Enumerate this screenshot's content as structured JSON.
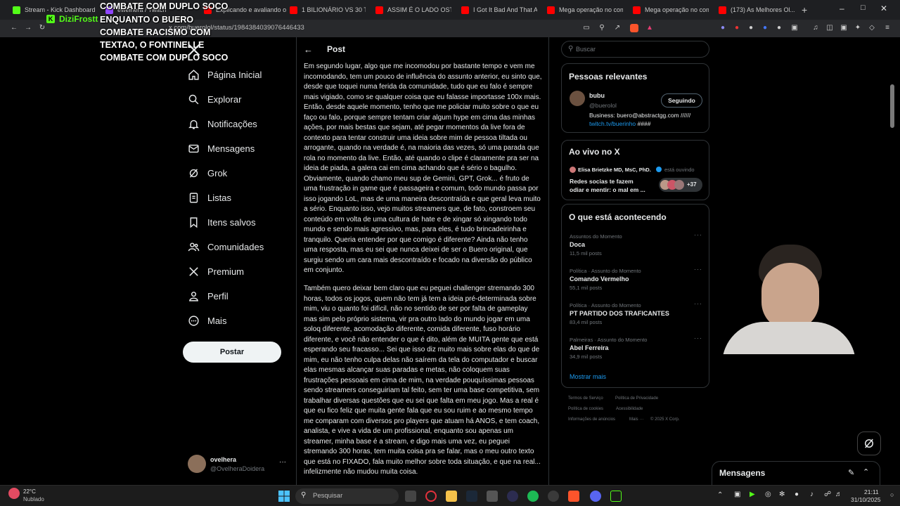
{
  "browser": {
    "tabs": [
      {
        "title": "Stream - Kick Dashboard",
        "color": "#53fc18"
      },
      {
        "title": "ewelhera / Twitch",
        "color": "#9146ff"
      },
      {
        "title": "Explicando e avaliando o...",
        "color": "#ff0000"
      },
      {
        "title": "1 BILIONÁRIO VS 30 TRA...",
        "color": "#ff0000"
      },
      {
        "title": "ASSIM É O LADO OSTEN...",
        "color": "#ff0000"
      },
      {
        "title": "I Got It Bad And That Ain...",
        "color": "#ff0000"
      },
      {
        "title": "Mega operação no comp...",
        "color": "#ff0000"
      },
      {
        "title": "Mega operação no comp...",
        "color": "#ff0000"
      },
      {
        "title": "(173) As Melhores Ol...",
        "color": "#ff0000"
      }
    ],
    "new_tab": "+",
    "url": "x.com/buerolol/status/1984384039076446433"
  },
  "overlay": {
    "brand": "DiziFrostt",
    "lines": [
      "COMBATE COM DUPLO SOCO",
      "ENQUANTO O BUERO",
      "COMBATE RACISMO COM",
      "TEXTAO, O FONTINELLE",
      "COMBATE COM DUPLO SOCO"
    ]
  },
  "nav": {
    "items": [
      {
        "label": "Página Inicial",
        "icon": "home-icon"
      },
      {
        "label": "Explorar",
        "icon": "search-icon"
      },
      {
        "label": "Notificações",
        "icon": "bell-icon"
      },
      {
        "label": "Mensagens",
        "icon": "mail-icon"
      },
      {
        "label": "Grok",
        "icon": "grok-icon"
      },
      {
        "label": "Listas",
        "icon": "list-icon"
      },
      {
        "label": "Itens salvos",
        "icon": "bookmark-icon"
      },
      {
        "label": "Comunidades",
        "icon": "people-icon"
      },
      {
        "label": "Premium",
        "icon": "x-logo-icon"
      },
      {
        "label": "Perfil",
        "icon": "person-icon"
      },
      {
        "label": "Mais",
        "icon": "more-circle-icon"
      }
    ],
    "post_button": "Postar",
    "account": {
      "name": "ovelhera",
      "handle": "@OvelheraDoidera"
    }
  },
  "post": {
    "header": "Post",
    "paragraph1": "Em segundo lugar, algo que me incomodou por bastante tempo e vem me incomodando, tem um pouco de influência do assunto anterior, eu sinto que, desde que toquei numa ferida da comunidade, tudo que eu falo é sempre mais vigiado, como se qualquer coisa que eu falasse importasse 100x mais. Então, desde aquele momento, tenho que me policiar muito sobre o que eu faço ou falo, porque sempre tentam criar algum hype em cima das minhas ações, por mais bestas que sejam, até pegar momentos da live fora de contexto para tentar construir uma ideia sobre mim de pessoa tiltada ou arrogante, quando na verdade é, na maioria das vezes, só uma parada que rola no momento da live. Então, até quando o clipe é claramente pra ser na ideia de piada, a galera cai em cima achando que é sério o bagulho. Obviamente, quando chamo meu sup de Gemini, GPT, Grok... é fruto de uma frustração in game que é passageira e comum, todo mundo passa por isso jogando LoL, mas de uma maneira descontraída e que geral leva muito a sério. Enquanto isso, vejo muitos streamers que, de fato, constroem seu conteúdo em volta de uma cultura de hate e de xingar só xingando todo mundo e sendo mais agressivo, mas, para eles, é tudo brincadeirinha e tranquilo. Queria entender por que comigo é diferente? Ainda não tenho uma resposta, mas eu sei que nunca deixei de ser o Buero original, que surgiu sendo um cara mais descontraído e focado na diversão do público em conjunto.",
    "paragraph2": "Também quero deixar bem claro que eu peguei challenger stremando 300 horas, todos os jogos, quem não tem já tem a ideia pré-determinada sobre mim, viu o quanto foi difícil, não no sentido de ser por falta de gameplay mas sim pelo próprio sistema, vir pra outro lado do mundo jogar em uma soloq diferente, acomodação diferente, comida diferente, fuso horário diferente, e você não entender o que é dito, além de MUITA gente que está esperando seu fracasso... Sei que isso diz muito mais sobre elas do que de mim, eu não tenho culpa delas não saírem da tela do computador e buscar elas mesmas alcançar suas paradas e metas, não coloquem suas frustrações pessoais em cima de mim, na verdade pouquíssimas pessoas sendo streamers conseguiriam tal feito, sem ter uma base competitiva, sem trabalhar diversas questões que eu sei que falta em meu jogo. Mas a real é que eu fico feliz que muita gente fala que eu sou ruim e ao mesmo tempo me comparam com diversos pro players que atuam há ANOS, e tem coach, analista, e vive a vida de um profissional, enquanto sou apenas um streamer, minha base é a stream, e digo mais uma vez, eu peguei stremando 300 horas, tem muita coisa pra se falar, mas o meu outro texto que está no FIXADO, fala muito melhor sobre toda situação, e que na real... infelizmente não mudou muita coisa."
  },
  "search": {
    "placeholder": "Buscar"
  },
  "relevant": {
    "title": "Pessoas relevantes",
    "name": "bubu",
    "handle": "@buerolol",
    "follow_button": "Seguindo",
    "bio_line1": "Business: buero@abstractgg.com //////",
    "bio_link": "twitch.tv/buerinho",
    "bio_suffix": " ####"
  },
  "live": {
    "title": "Ao vivo no X",
    "host": "Elisa Brietzke MD, MsC, PhD.",
    "status": "está ouvindo",
    "space_line1": "Redes socias te fazem",
    "space_line2": "odiar e mentir: o mal em ...",
    "listeners": "+37"
  },
  "trends": {
    "title": "O que está acontecendo",
    "items": [
      {
        "category": "Assuntos do Momento",
        "name": "Doca",
        "count": "11,5 mil posts"
      },
      {
        "category": "Política · Assunto do Momento",
        "name": "Comando Vermelho",
        "count": "55,1 mil posts"
      },
      {
        "category": "Política · Assunto do Momento",
        "name": "PT PARTIDO DOS TRAFICANTES",
        "count": "83,4 mil posts"
      },
      {
        "category": "Palmeiras · Assunto do Momento",
        "name": "Abel Ferreira",
        "count": "34,9 mil posts"
      }
    ],
    "show_more": "Mostrar mais"
  },
  "footer": {
    "links": [
      "Termos de Serviço",
      "Política de Privacidade",
      "Política de cookies",
      "Acessibilidade",
      "Informações de anúncios",
      "Mais ···",
      "© 2025 X Corp."
    ]
  },
  "messages": {
    "title": "Mensagens"
  },
  "taskbar": {
    "weather_temp": "22°C",
    "weather_desc": "Nublado",
    "search_placeholder": "Pesquisar",
    "time": "21:11",
    "date": "31/10/2025"
  },
  "colors": {
    "accent": "#1d9bf0",
    "kick": "#53fc18"
  }
}
